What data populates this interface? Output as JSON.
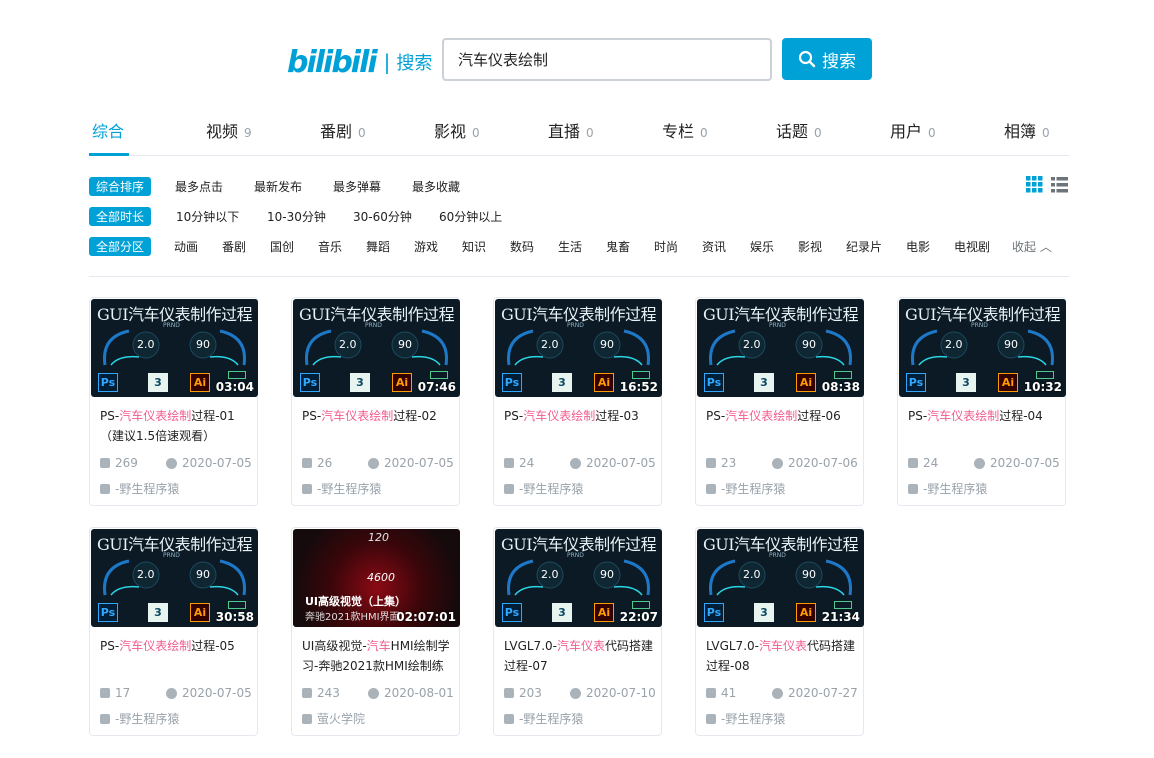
{
  "header": {
    "logo": "bilibili",
    "logo_suffix": "搜索",
    "search_value": "汽车仪表绘制",
    "search_button": "搜索"
  },
  "tabs": [
    {
      "label": "综合",
      "count": ""
    },
    {
      "label": "视频",
      "count": "9"
    },
    {
      "label": "番剧",
      "count": "0"
    },
    {
      "label": "影视",
      "count": "0"
    },
    {
      "label": "直播",
      "count": "0"
    },
    {
      "label": "专栏",
      "count": "0"
    },
    {
      "label": "话题",
      "count": "0"
    },
    {
      "label": "用户",
      "count": "0"
    },
    {
      "label": "相簿",
      "count": "0"
    }
  ],
  "filters": {
    "sort": {
      "selected": "综合排序",
      "options": [
        "最多点击",
        "最新发布",
        "最多弹幕",
        "最多收藏"
      ]
    },
    "duration": {
      "selected": "全部时长",
      "options": [
        "10分钟以下",
        "10-30分钟",
        "30-60分钟",
        "60分钟以上"
      ]
    },
    "zone": {
      "selected": "全部分区",
      "options": [
        "动画",
        "番剧",
        "国创",
        "音乐",
        "舞蹈",
        "游戏",
        "知识",
        "数码",
        "生活",
        "鬼畜",
        "时尚",
        "资讯",
        "娱乐",
        "影视",
        "纪录片",
        "电影",
        "电视剧"
      ],
      "collapse": "收起"
    }
  },
  "thumb_title": "GUI汽车仪表制作过程",
  "videos": [
    {
      "title_pre": "PS-",
      "title_hl": "汽车仪表绘制",
      "title_post": "过程-01（建议1.5倍速观看）",
      "duration": "03:04",
      "plays": "269",
      "date": "2020-07-05",
      "up": "-野生程序猿"
    },
    {
      "title_pre": "PS-",
      "title_hl": "汽车仪表绘制",
      "title_post": "过程-02",
      "duration": "07:46",
      "plays": "26",
      "date": "2020-07-05",
      "up": "-野生程序猿"
    },
    {
      "title_pre": "PS-",
      "title_hl": "汽车仪表绘制",
      "title_post": "过程-03",
      "duration": "16:52",
      "plays": "24",
      "date": "2020-07-05",
      "up": "-野生程序猿"
    },
    {
      "title_pre": "PS-",
      "title_hl": "汽车仪表绘制",
      "title_post": "过程-06",
      "duration": "08:38",
      "plays": "23",
      "date": "2020-07-06",
      "up": "-野生程序猿"
    },
    {
      "title_pre": "PS-",
      "title_hl": "汽车仪表绘制",
      "title_post": "过程-04",
      "duration": "10:32",
      "plays": "24",
      "date": "2020-07-05",
      "up": "-野生程序猿"
    },
    {
      "title_pre": "PS-",
      "title_hl": "汽车仪表绘制",
      "title_post": "过程-05",
      "duration": "30:58",
      "plays": "17",
      "date": "2020-07-05",
      "up": "-野生程序猿"
    },
    {
      "title_pre": "UI高级视觉-",
      "title_hl": "汽车",
      "title_post": "HMI绘制学习-奔驰2021款HMI绘制练",
      "duration": "02:07:01",
      "plays": "243",
      "date": "2020-08-01",
      "up": "萤火学院",
      "thumb_caption": "UI高级视觉（上集）",
      "thumb_sub": "奔驰2021款HMI界面",
      "thumb_num1": "120",
      "thumb_num2": "4600"
    },
    {
      "title_pre": "LVGL7.0-",
      "title_hl": "汽车仪表",
      "title_post": "代码搭建过程-07",
      "duration": "22:07",
      "plays": "203",
      "date": "2020-07-10",
      "up": "-野生程序猿"
    },
    {
      "title_pre": "LVGL7.0-",
      "title_hl": "汽车仪表",
      "title_post": "代码搭建过程-08",
      "duration": "21:34",
      "plays": "41",
      "date": "2020-07-27",
      "up": "-野生程序猿"
    }
  ],
  "thumb_gauges": {
    "left": "2.0",
    "right": "90",
    "prnd": "PRND"
  },
  "thumb_apps": {
    "ps": "Ps",
    "c4d": "3",
    "ai": "Ai"
  }
}
